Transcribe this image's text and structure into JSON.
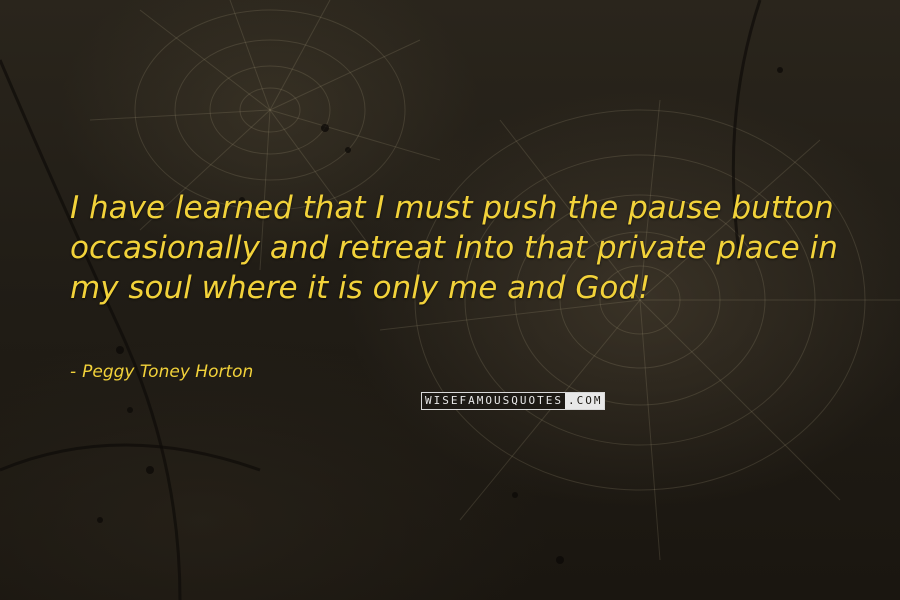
{
  "quote": {
    "text": "I have learned that I must push the pause button occasionally and retreat into that private place in my soul where it is only me and God!",
    "author_dash": "-",
    "author": "Peggy Toney Horton"
  },
  "watermark": {
    "part_a": "WISEFAMOUSQUOTES",
    "part_b": ".COM"
  },
  "colors": {
    "text": "#f2d23a",
    "background": "#1b1710"
  }
}
